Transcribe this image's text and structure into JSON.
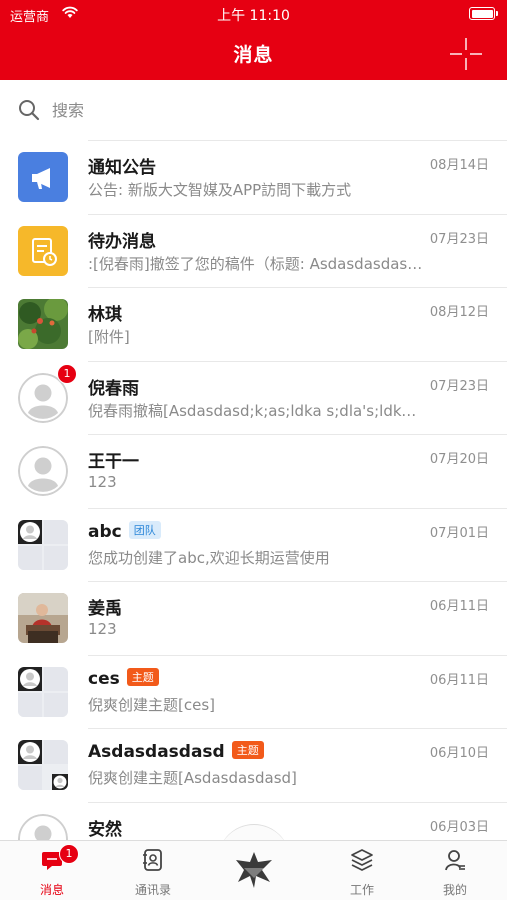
{
  "status_bar": {
    "carrier": "运营商",
    "time": "上午 11:10"
  },
  "header": {
    "title": "消息"
  },
  "search": {
    "placeholder": "搜索"
  },
  "messages": [
    {
      "name": "通知公告",
      "date": "08月14日",
      "preview": "公告: 新版大文智媒及APP訪問下載方式",
      "avatar": "announcement-icon",
      "color": "#4a7fe0"
    },
    {
      "name": "待办消息",
      "date": "07月23日",
      "preview": ":[倪春雨]撤签了您的稿件（标题: Asdasdasdasdasd",
      "avatar": "todo-icon",
      "color": "#f6b82a"
    },
    {
      "name": "林琪",
      "date": "08月12日",
      "preview": "[附件]",
      "avatar": "photo-avatar"
    },
    {
      "name": "倪春雨",
      "date": "07月23日",
      "preview": "倪春雨撤稿[Asdasdasd;k;as;ldka s;dla's;ldkas;ld",
      "avatar": "default-avatar",
      "badge": "1"
    },
    {
      "name": "王干一",
      "date": "07月20日",
      "preview": "123",
      "avatar": "default-avatar"
    },
    {
      "name": "abc",
      "tag": "团队",
      "date": "07月01日",
      "preview": "您成功创建了abc,欢迎长期运营使用",
      "avatar": "group-avatar"
    },
    {
      "name": "姜禹",
      "date": "06月11日",
      "preview": "123",
      "avatar": "photo-avatar"
    },
    {
      "name": "ces",
      "tag": "主题",
      "date": "06月11日",
      "preview": "倪爽创建主题[ces]",
      "avatar": "group-avatar"
    },
    {
      "name": "Asdasdasdasd",
      "tag": "主题",
      "date": "06月10日",
      "preview": "倪爽创建主题[Asdasdasdasd]",
      "avatar": "group-avatar"
    },
    {
      "name": "安然",
      "date": "06月03日",
      "preview": "",
      "avatar": "default-avatar"
    }
  ],
  "tabbar": {
    "items": [
      {
        "label": "消息",
        "icon": "chat-icon",
        "badge": "1",
        "active": true
      },
      {
        "label": "通讯录",
        "icon": "contacts-icon"
      },
      {
        "label": "",
        "icon": "app-logo-icon"
      },
      {
        "label": "工作",
        "icon": "layers-icon"
      },
      {
        "label": "我的",
        "icon": "profile-icon"
      }
    ]
  },
  "colors": {
    "brand": "#e60012",
    "team_tag": "#2a86d8",
    "topic_tag": "#f25a1a"
  }
}
